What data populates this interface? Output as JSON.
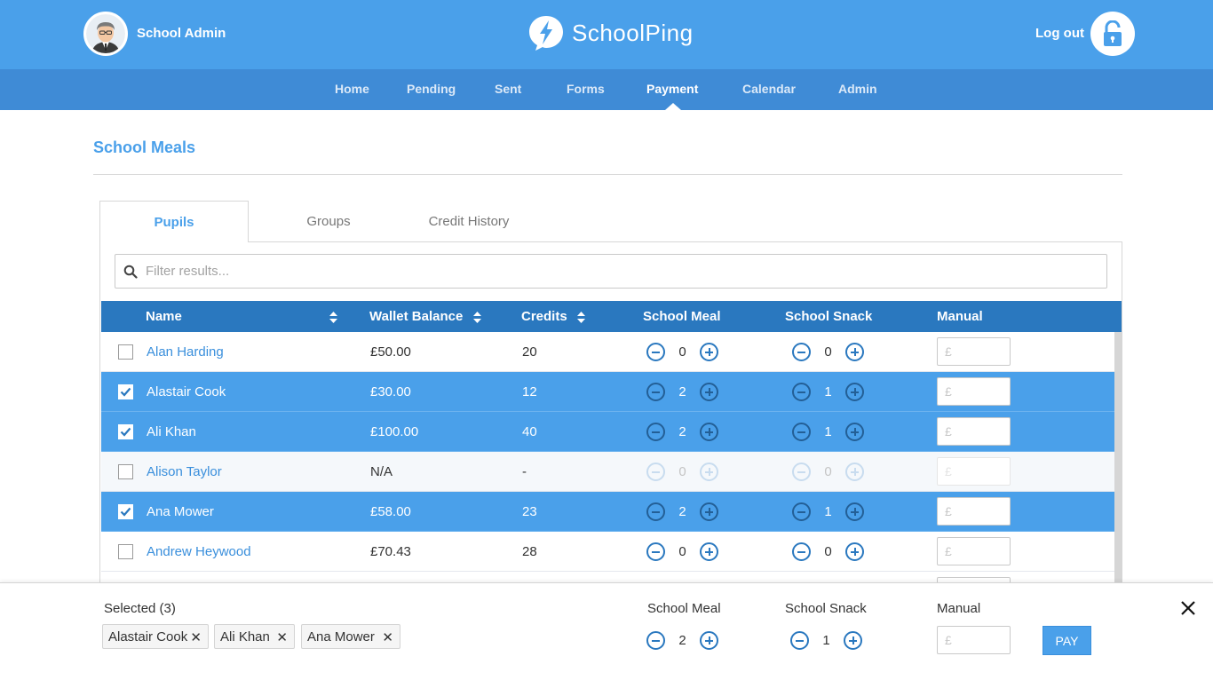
{
  "header": {
    "user_name": "School Admin",
    "brand": "SchoolPing",
    "logout_label": "Log out",
    "brand_color": "#4aa0ea"
  },
  "nav": {
    "items": [
      "Home",
      "Pending",
      "Sent",
      "Forms",
      "Payment",
      "Calendar",
      "Admin"
    ],
    "active": "Payment"
  },
  "page": {
    "title": "School Meals"
  },
  "tabs": [
    "Pupils",
    "Groups",
    "Credit History"
  ],
  "filter": {
    "placeholder": "Filter results..."
  },
  "table": {
    "columns": [
      "Name",
      "Wallet Balance",
      "Credits",
      "School Meal",
      "School Snack",
      "Manual"
    ],
    "currency_placeholder": "£",
    "rows": [
      {
        "name": "Alan Harding",
        "balance": "£50.00",
        "credits": "20",
        "meal": "0",
        "snack": "0",
        "selected": false,
        "disabled": false
      },
      {
        "name": "Alastair Cook",
        "balance": "£30.00",
        "credits": "12",
        "meal": "2",
        "snack": "1",
        "selected": true,
        "disabled": false
      },
      {
        "name": "Ali Khan",
        "balance": "£100.00",
        "credits": "40",
        "meal": "2",
        "snack": "1",
        "selected": true,
        "disabled": false
      },
      {
        "name": "Alison Taylor",
        "balance": "N/A",
        "credits": "-",
        "meal": "0",
        "snack": "0",
        "selected": false,
        "disabled": true
      },
      {
        "name": "Ana Mower",
        "balance": "£58.00",
        "credits": "23",
        "meal": "2",
        "snack": "1",
        "selected": true,
        "disabled": false
      },
      {
        "name": "Andrew Heywood",
        "balance": "£70.43",
        "credits": "28",
        "meal": "0",
        "snack": "0",
        "selected": false,
        "disabled": false
      }
    ]
  },
  "selection": {
    "label": "Selected (3)",
    "chips": [
      "Alastair Cook",
      "Ali Khan",
      "Ana Mower"
    ],
    "meal_label": "School Meal",
    "snack_label": "School Snack",
    "manual_label": "Manual",
    "meal_value": "2",
    "snack_value": "1",
    "pay_label": "PAY"
  }
}
